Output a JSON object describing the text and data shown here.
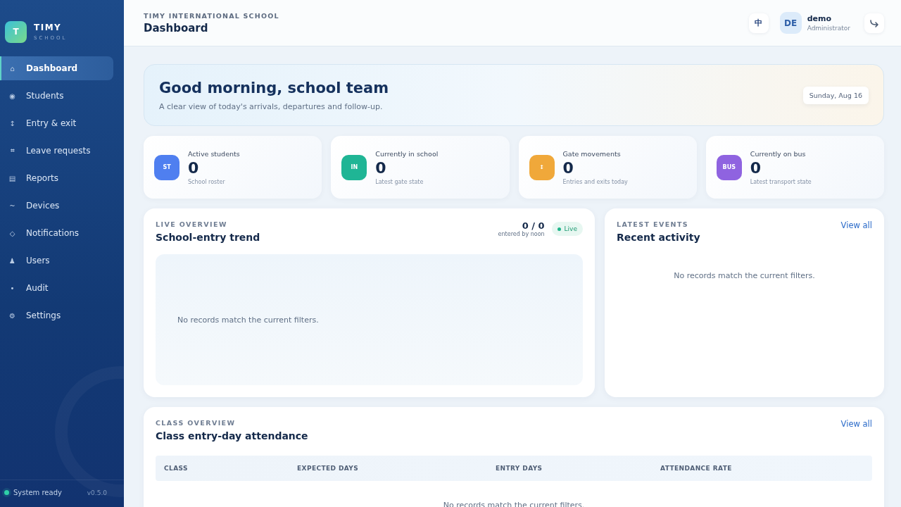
{
  "brand": {
    "logo": "T",
    "name": "TIMY",
    "subtitle": "SCHOOL"
  },
  "sidebar": {
    "items": [
      {
        "icon": "⌂",
        "label": "Dashboard",
        "selected": true
      },
      {
        "icon": "◉",
        "label": "Students",
        "selected": false
      },
      {
        "icon": "↕",
        "label": "Entry & exit",
        "selected": false
      },
      {
        "icon": "⌗",
        "label": "Leave requests",
        "selected": false
      },
      {
        "icon": "▤",
        "label": "Reports",
        "selected": false
      },
      {
        "icon": "~",
        "label": "Devices",
        "selected": false
      },
      {
        "icon": "◇",
        "label": "Notifications",
        "selected": false
      },
      {
        "icon": "♟",
        "label": "Users",
        "selected": false
      },
      {
        "icon": "•",
        "label": "Audit",
        "selected": false
      },
      {
        "icon": "⚙",
        "label": "Settings",
        "selected": false
      }
    ],
    "status": "System ready",
    "version": "v0.5.0"
  },
  "header": {
    "school": "TIMY INTERNATIONAL SCHOOL",
    "title": "Dashboard",
    "language": "中",
    "avatar": "DE",
    "user": "demo",
    "role": "Administrator"
  },
  "hero": {
    "greeting": "Good morning, school team",
    "subtitle": "A clear view of today's arrivals, departures and follow-up.",
    "date": "Sunday, Aug 16"
  },
  "stats": [
    {
      "badge": "ST",
      "color": "#4f7ff0",
      "label": "Active students",
      "value": "0",
      "note": "School roster"
    },
    {
      "badge": "IN",
      "color": "#1fb595",
      "label": "Currently in school",
      "value": "0",
      "note": "Latest gate state"
    },
    {
      "badge": "↕",
      "color": "#f0a83a",
      "label": "Gate movements",
      "value": "0",
      "note": "Entries and exits today"
    },
    {
      "badge": "BUS",
      "color": "#8f63e0",
      "label": "Currently on bus",
      "value": "0",
      "note": "Latest transport state"
    }
  ],
  "trend": {
    "eyebrow": "LIVE OVERVIEW",
    "title": "School-entry trend",
    "ratio": "0 / 0",
    "ratio_note": "entered by noon",
    "live": "Live",
    "empty": "No records match the current filters."
  },
  "activity": {
    "eyebrow": "LATEST EVENTS",
    "title": "Recent activity",
    "link": "View all",
    "empty": "No records match the current filters."
  },
  "classes": {
    "eyebrow": "CLASS OVERVIEW",
    "title": "Class entry-day attendance",
    "link": "View all",
    "table": {
      "columns": [
        "CLASS",
        "EXPECTED DAYS",
        "ENTRY DAYS",
        "ATTENDANCE RATE"
      ]
    },
    "empty": "No records match the current filters."
  }
}
